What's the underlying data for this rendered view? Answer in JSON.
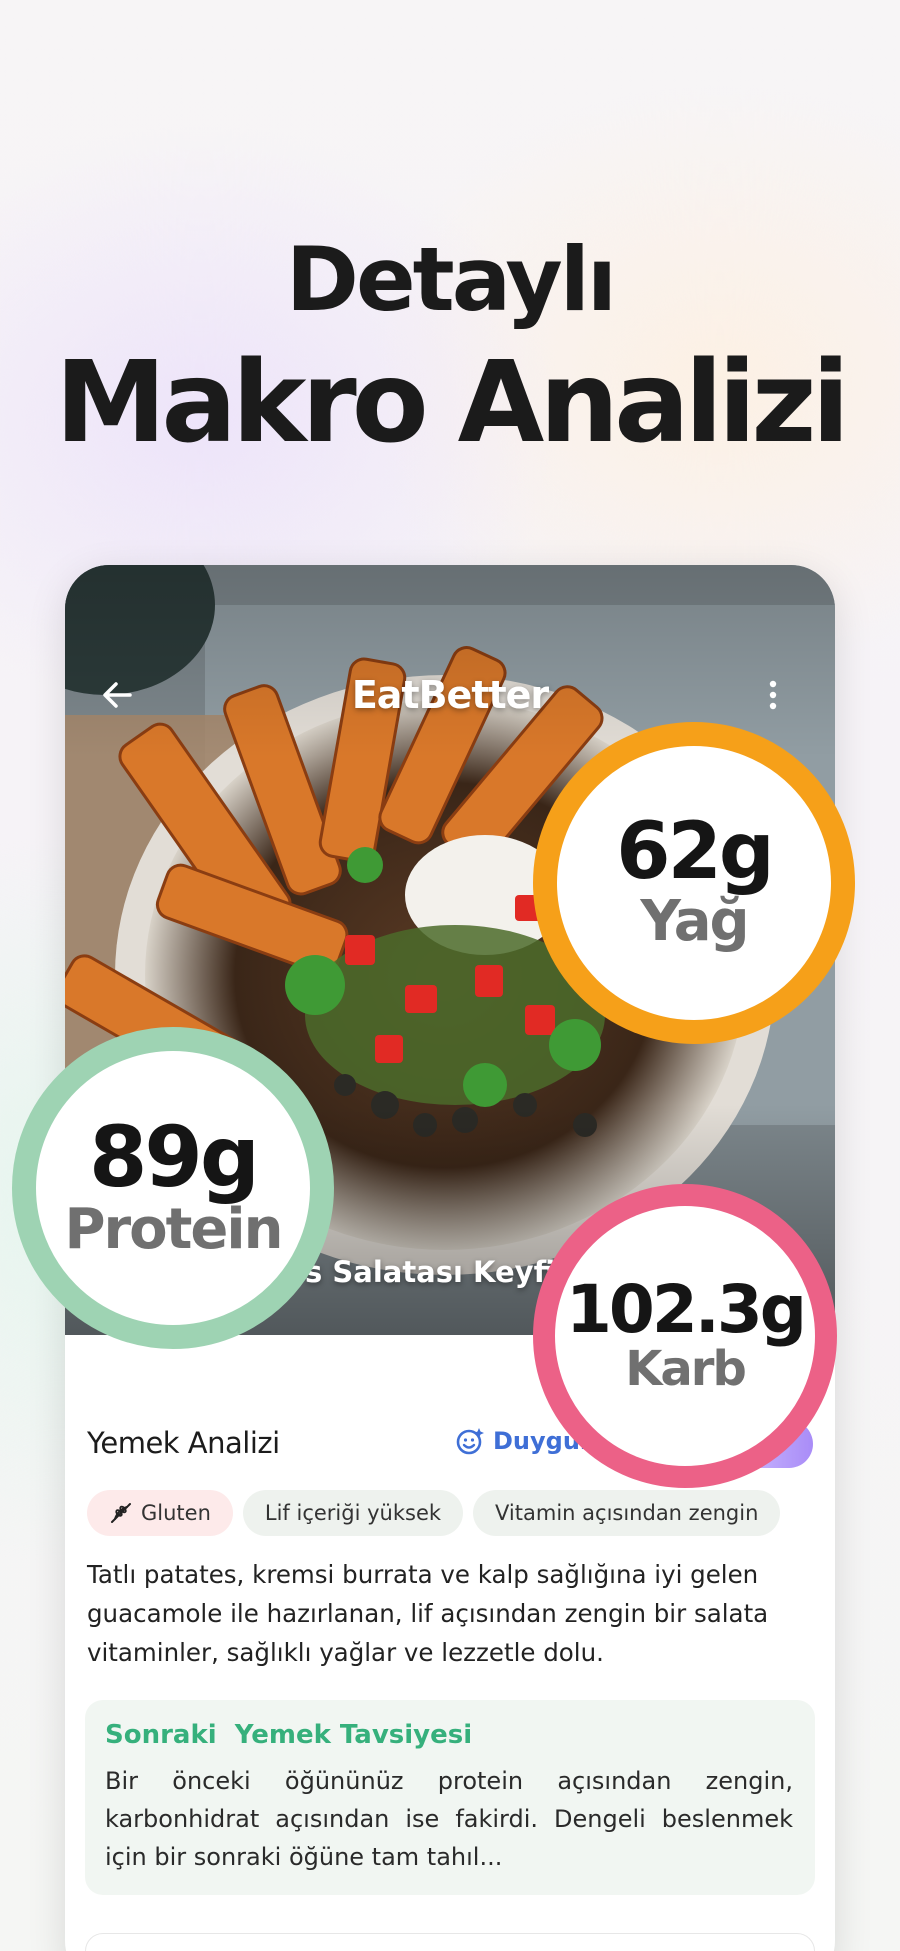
{
  "headline": {
    "line1": "Detaylı",
    "line2": "Makro Analizi"
  },
  "app": {
    "brand": "EatBetter"
  },
  "food": {
    "title": "s Salatası Keyfi"
  },
  "macros": {
    "fat": {
      "value": "62g",
      "label": "Yağ",
      "color": "#f6a019"
    },
    "protein": {
      "value": "89g",
      "label": "Protein",
      "color": "#9ed3b3"
    },
    "carb": {
      "value": "102.3g",
      "label": "Karb",
      "color": "#ec6187"
    }
  },
  "analysis": {
    "title": "Yemek Analizi",
    "mood_button": "Duygula",
    "chips": [
      {
        "label": "Gluten",
        "icon": "no-gluten-icon"
      },
      {
        "label": "Lif içeriği yüksek"
      },
      {
        "label": "Vitamin açısından zengin"
      }
    ],
    "description": "Tatlı patates, kremsi burrata ve kalp sağlığına iyi gelen guacamole ile hazırlanan, lif açısından zengin bir salata vitaminler, sağlıklı yağlar ve lezzetle dolu."
  },
  "recommendation": {
    "title": "Sonraki  Yemek Tavsiyesi",
    "text": "Bir önceki öğününüz protein açısından zengin, karbonhidrat açısından ise fakirdi. Dengeli beslenmek için bir sonraki öğüne tam tahıl..."
  },
  "colors": {
    "accent_green": "#36b07c",
    "accent_blue": "#3f6fd6"
  }
}
